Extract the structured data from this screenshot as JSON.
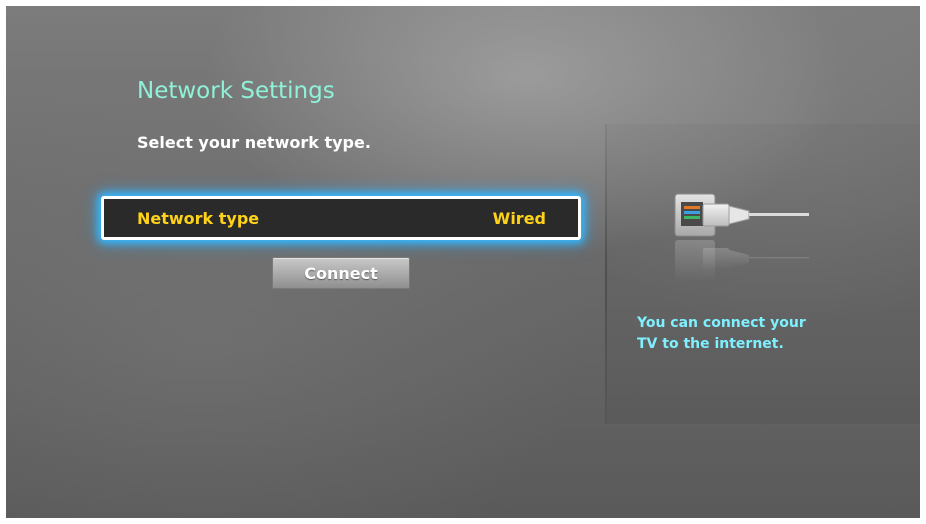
{
  "header": {
    "title": "Network Settings",
    "subtitle": "Select your network type."
  },
  "setting": {
    "label": "Network type",
    "value": "Wired"
  },
  "actions": {
    "connect_label": "Connect"
  },
  "info_panel": {
    "illustration_icon": "ethernet-cable-icon",
    "line1": "You can connect your",
    "line2": "TV to the internet."
  },
  "colors": {
    "title": "#8ff2d8",
    "setting_text": "#ffd21a",
    "focus_glow": "#35b9ff",
    "info_text": "#7ff0ff"
  }
}
